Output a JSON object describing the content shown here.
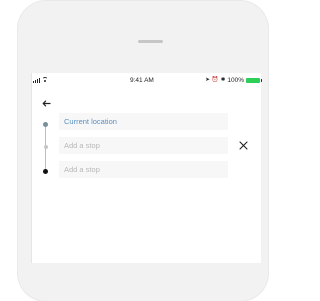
{
  "status_bar": {
    "signal_icon": "signal-bars-icon",
    "wifi_icon": "wifi-icon",
    "time": "9:41 AM",
    "location_icon": "location-arrow-icon",
    "alarm_icon": "alarm-icon",
    "bluetooth_icon": "bluetooth-icon",
    "battery_percent_text": "100%",
    "battery_color": "#2ECF58"
  },
  "header": {
    "back_icon": "back-arrow-icon"
  },
  "route": {
    "current_location_label": "Current location",
    "stop_1_placeholder": "Add a stop",
    "stop_2_placeholder": "Add a stop"
  },
  "actions": {
    "close_icon": "close-icon"
  },
  "colors": {
    "accent_text": "#5A8FC0",
    "placeholder_text": "#B8B8B8",
    "field_bg": "#F7F7F7",
    "shell_bg": "#F2F2F2"
  }
}
